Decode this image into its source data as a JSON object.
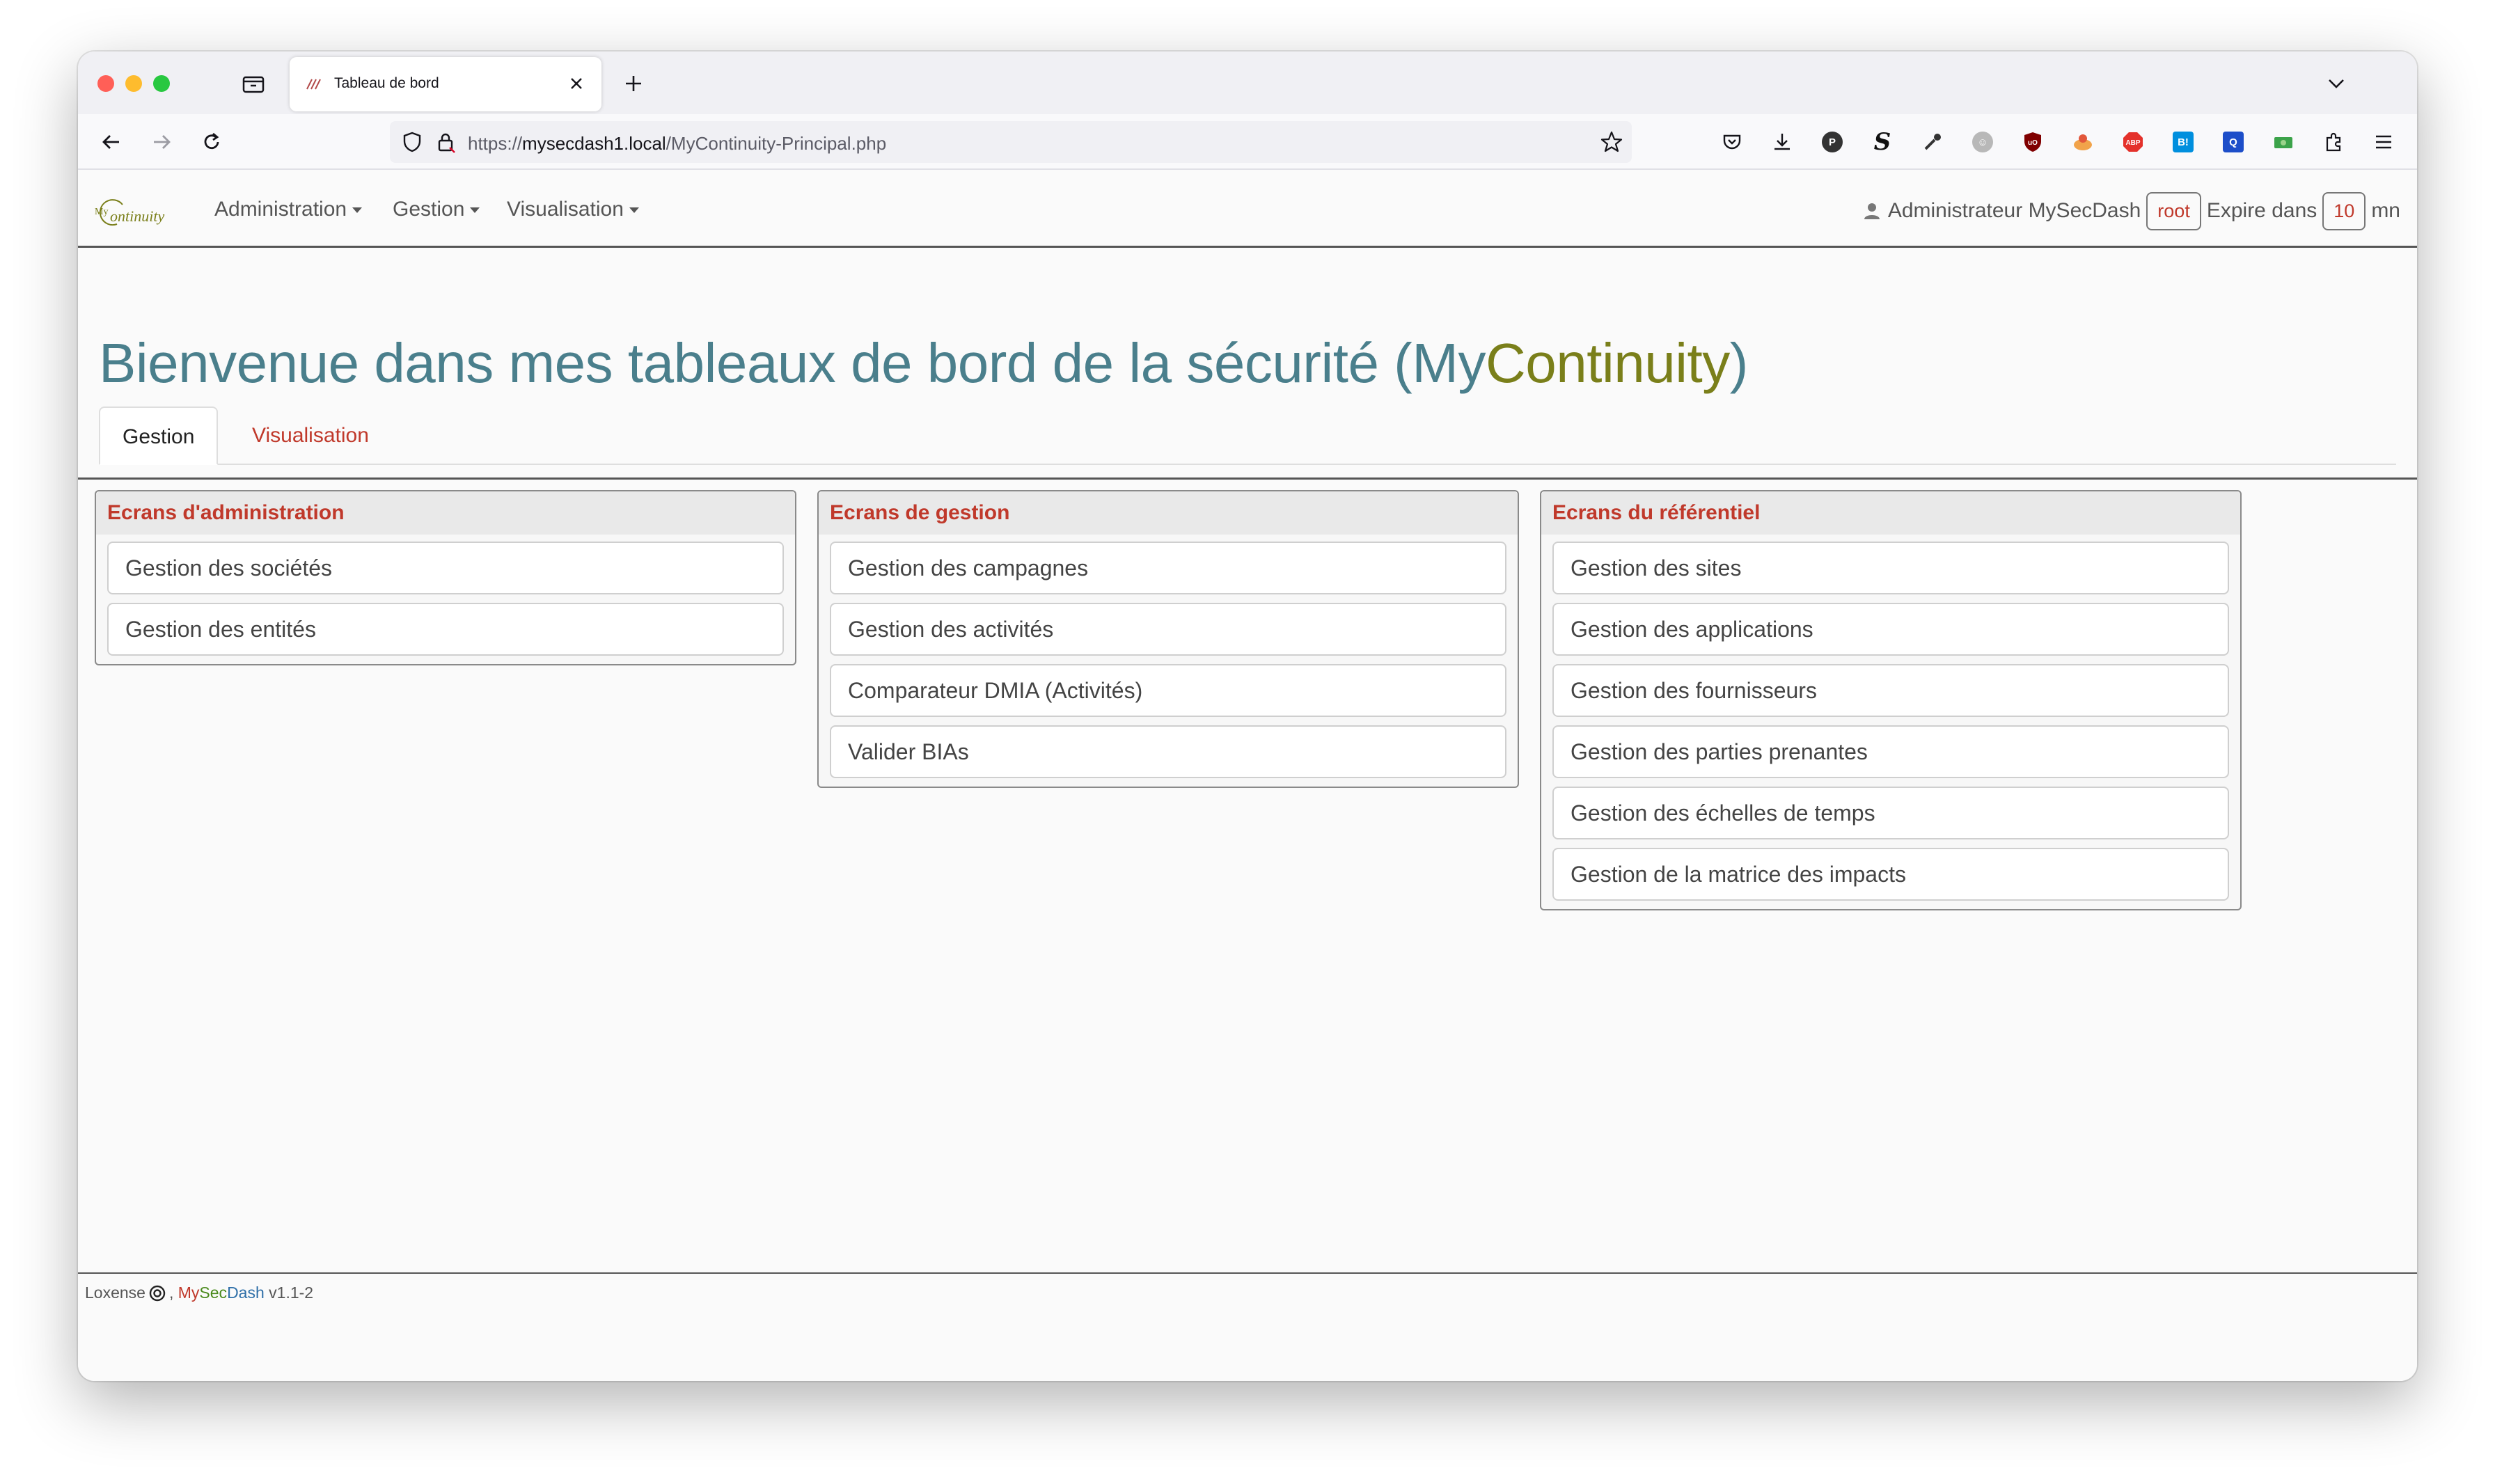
{
  "browser": {
    "tab_title": "Tableau de bord",
    "url_prefix": "https://",
    "url_host": "mysecdash1.local",
    "url_path": "/MyContinuity-Principal.php"
  },
  "nav": {
    "menus": [
      "Administration",
      "Gestion",
      "Visualisation"
    ],
    "user_label": "Administrateur MySecDash",
    "user_login": "root",
    "expire_label": "Expire dans",
    "expire_value": "10",
    "expire_unit": "mn"
  },
  "welcome": {
    "title_prefix": "Bienvenue dans mes tableaux de bord de la sécurité (My",
    "title_brand": "Continuity",
    "title_suffix": ")"
  },
  "tabs": [
    "Gestion",
    "Visualisation"
  ],
  "panels": [
    {
      "title": "Ecrans d'administration",
      "items": [
        "Gestion des sociétés",
        "Gestion des entités"
      ]
    },
    {
      "title": "Ecrans de gestion",
      "items": [
        "Gestion des campagnes",
        "Gestion des activités",
        "Comparateur DMIA (Activités)",
        "Valider BIAs"
      ]
    },
    {
      "title": "Ecrans du référentiel",
      "items": [
        "Gestion des sites",
        "Gestion des applications",
        "Gestion des fournisseurs",
        "Gestion des parties prenantes",
        "Gestion des échelles de temps",
        "Gestion de la matrice des impacts"
      ]
    }
  ],
  "footer": {
    "company": "Loxense",
    "product_my": "My",
    "product_sec": "Sec",
    "product_dash": "Dash",
    "version": "v1.1-2"
  },
  "colors": {
    "title_teal": "#4a7f8c",
    "brand_olive": "#7a7f1a",
    "accent_red": "#c0392b"
  }
}
